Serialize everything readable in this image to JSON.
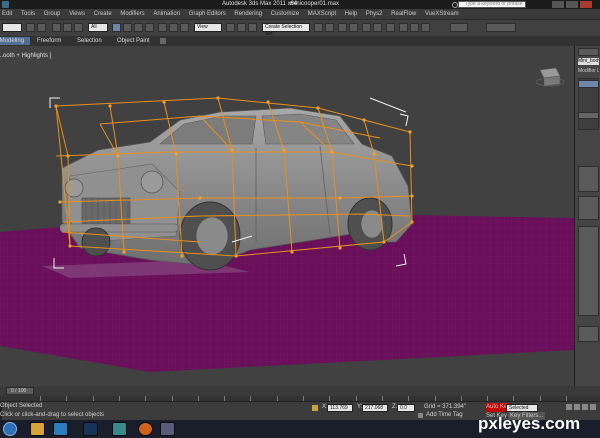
{
  "title_bar": {
    "app_title": "Autodesk 3ds Max  2011 x64",
    "file_name": "minicooper01.max",
    "search_placeholder": "Type a keyword or phrase"
  },
  "menu": {
    "items": [
      "Edit",
      "Tools",
      "Group",
      "Views",
      "Create",
      "Modifiers",
      "Animation",
      "Graph Editors",
      "Rendering",
      "Customize",
      "MAXScript",
      "Help",
      "Phys2",
      "RealFlow",
      "VueXStream"
    ]
  },
  "toolbar": {
    "selection_filter": "All",
    "reference_coord": "View",
    "named_selection": "Create Selection Set",
    "left_field": ""
  },
  "ribbon": {
    "tabs": [
      "Graphite Modeling Tools",
      "Freeform",
      "Selection",
      "Object Paint"
    ]
  },
  "viewport": {
    "label": "[ + ] [ Perspective ] [ Smooth + Highlights ]",
    "label_visible": "...ooth + Highlights ]"
  },
  "command_panel": {
    "object_name": "Mini_body",
    "modifier_list": "Modifier List"
  },
  "timeline": {
    "frame_label": "0 / 100",
    "ticks": [
      "0",
      "5",
      "10",
      "15",
      "20",
      "25",
      "30",
      "35",
      "40",
      "45",
      "50",
      "55",
      "60",
      "65",
      "70",
      "75",
      "80",
      "85",
      "90",
      "95",
      "100"
    ]
  },
  "status": {
    "selection_text": "Object Selected",
    "prompt_text": "Click or click-and-drag to select objects",
    "x_value": "113.769",
    "y_value": "217.068",
    "z_value": "0.0",
    "grid_text": "Grid = 371.394\"",
    "auto_key_label": "Auto Key",
    "auto_key_dropdown": "Selected",
    "set_key_label": "Set Key",
    "key_filters_label": "Key Filters...",
    "add_time_tag": "Add Time Tag"
  },
  "watermark": {
    "text": "pxleyes.com"
  },
  "colors": {
    "viewport_bg": "#414141",
    "ground_plane": "#6a0f5a",
    "ffd_lattice": "#e8901c",
    "car_body": "#8a8a8a",
    "auto_key_active": "#c40000"
  }
}
